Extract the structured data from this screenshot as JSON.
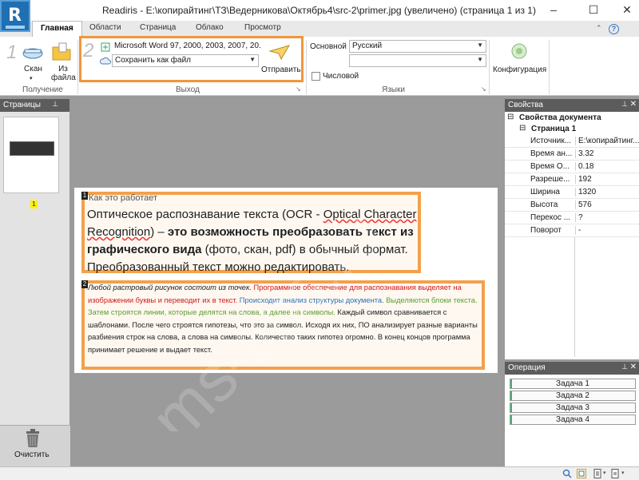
{
  "window": {
    "title": "Readiris - E:\\копирайтинг\\ТЗ\\Ведерникова\\Октябрь4\\src-2\\primer.jpg (увеличено) (страница 1 из 1)",
    "controls": [
      "–",
      "☐",
      "✕"
    ]
  },
  "ribbon": {
    "tabs": [
      "Главная",
      "Области",
      "Страница",
      "Облако",
      "Просмотр"
    ],
    "active_tab": "Главная",
    "acquire": {
      "step_number": "1",
      "scan_label": "Скан",
      "scan_arrow": "▾",
      "from_file_label": "Из файла",
      "group_label": "Получение"
    },
    "output": {
      "step_number": "2",
      "format_value": "Microsoft Word 97, 2000, 2003, 2007, 20...",
      "save_value": "Сохранить как файл",
      "send_label": "Отправить",
      "group_label": "Выход"
    },
    "languages": {
      "main_label": "Основной",
      "main_value": "Русский",
      "secondary_value": "",
      "numeric_label": "Числовой",
      "numeric_checked": false,
      "group_label": "Языки"
    },
    "configuration_label": "Конфигурация"
  },
  "pages_pane": {
    "title": "Страницы",
    "page_number": "1",
    "clear_label": "Очистить"
  },
  "document": {
    "zone1_number": "1",
    "zone1_heading": "Как это работает",
    "zone1_parts": {
      "p1": "Оптическое распознавание текста (OCR - ",
      "p2": "Optical Character Recognition",
      "p3": ") – ",
      "p4": "это возможность  преобразовать текст из графического вида",
      "p5": " (фото, скан, pdf) в обычный формат. Преобразованный текст можно редактировать."
    },
    "zone2_number": "2",
    "zone2_parts": {
      "s1": "Любой растровый рисунок состоит из точек.",
      "s2": " Программное обеспечение для распознавания выделяет на изображении буквы и переводит их в текст.",
      "s3": " Происходит анализ структуры документа.",
      "s4": " Выделяются блоки текста. Затем строятся линии, которые делятся на слова, а далее на символы.",
      "s5": " Каждый символ сравнивается с шаблонами. После чего строятся гипотезы, что это за символ. Исходя их них, ПО анализирует разные варианты разбиения строк на слова, а слова на символы. Количество таких гипотез огромно. В конец концов программа принимает решение и выдает текст."
    }
  },
  "properties_pane": {
    "title": "Свойства",
    "group_document": "Свойства документа",
    "group_page": "Страница 1",
    "rows": [
      {
        "key": "Источник...",
        "value": "E:\\копирайтинг..."
      },
      {
        "key": "Время ан...",
        "value": "3.32"
      },
      {
        "key": "Время О...",
        "value": "0.18"
      },
      {
        "key": "Разреше...",
        "value": "192"
      },
      {
        "key": "Ширина",
        "value": "1320"
      },
      {
        "key": "Высота",
        "value": "576"
      },
      {
        "key": "Перекос ...",
        "value": "?"
      },
      {
        "key": "Поворот",
        "value": "-"
      }
    ]
  },
  "operations_pane": {
    "title": "Операция",
    "tasks": [
      "Задача 1",
      "Задача 2",
      "Задача 3",
      "Задача 4"
    ]
  },
  "watermark": "ms-tips.ru",
  "colors": {
    "accent": "#f0963c",
    "logo": "#1f6fb3",
    "pane_header": "#5c5c5c"
  }
}
